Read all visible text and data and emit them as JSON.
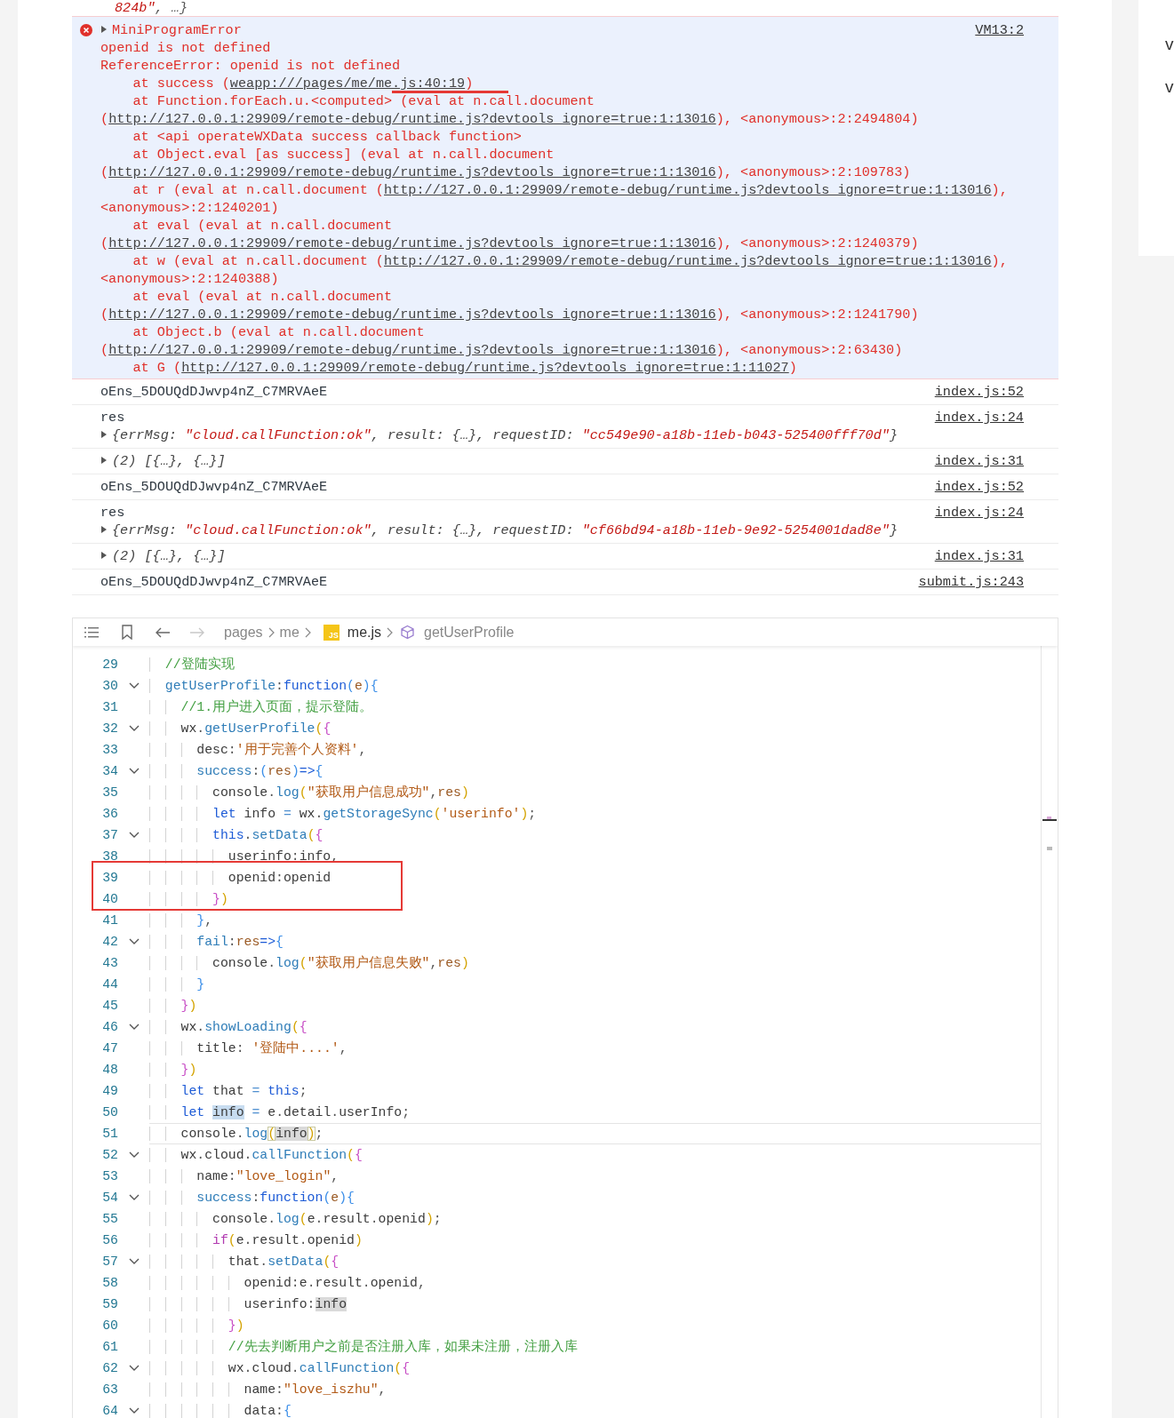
{
  "console": {
    "rows": [
      {
        "kind": "continuation",
        "parts": [
          {
            "kind": "string",
            "text": "824b\""
          },
          {
            "kind": "plain",
            "text": ", …}"
          }
        ]
      },
      {
        "kind": "error",
        "title": "MiniProgramError",
        "expanded": false,
        "source": "VM13:2",
        "lines": [
          {
            "kind": "message",
            "text": "openid is not defined"
          },
          {
            "kind": "message",
            "text": "ReferenceError: openid is not defined"
          },
          {
            "kind": "frame",
            "text": "at success (",
            "link": "weapp:///pages/me/me.js:40:19",
            "after": ")"
          },
          {
            "kind": "frame",
            "text": "at Function.forEach.u.<computed> (eval at n.call.document (",
            "link": "http://127.0.0.1:29909/remote-debug/runtime.js?devtools_ignore=true:1:13016",
            "after": "), <anonymous>:2:2494804)"
          },
          {
            "kind": "frame",
            "text": "at <api operateWXData success callback function>"
          },
          {
            "kind": "frame",
            "text": "at Object.eval [as success] (eval at n.call.document (",
            "link": "http://127.0.0.1:29909/remote-debug/runtime.js?devtools_ignore=true:1:13016",
            "after": "), <anonymous>:2:109783)"
          },
          {
            "kind": "frame",
            "text": "at r (eval at n.call.document (",
            "link": "http://127.0.0.1:29909/remote-debug/runtime.js?devtools_ignore=true:1:13016",
            "after": "), <anonymous>:2:1240201)"
          },
          {
            "kind": "frame",
            "text": "at eval (eval at n.call.document (",
            "link": "http://127.0.0.1:29909/remote-debug/runtime.js?devtools_ignore=true:1:13016",
            "after": "), <anonymous>:2:1240379)"
          },
          {
            "kind": "frame",
            "text": "at w (eval at n.call.document (",
            "link": "http://127.0.0.1:29909/remote-debug/runtime.js?devtools_ignore=true:1:13016",
            "after": "), <anonymous>:2:1240388)"
          },
          {
            "kind": "frame",
            "text": "at eval (eval at n.call.document (",
            "link": "http://127.0.0.1:29909/remote-debug/runtime.js?devtools_ignore=true:1:13016",
            "after": "), <anonymous>:2:1241790)"
          },
          {
            "kind": "frame",
            "text": "at Object.b (eval at n.call.document (",
            "link": "http://127.0.0.1:29909/remote-debug/runtime.js?devtools_ignore=true:1:13016",
            "after": "), <anonymous>:2:63430)"
          },
          {
            "kind": "frame",
            "text": "at G (",
            "link": "http://127.0.0.1:29909/remote-debug/runtime.js?devtools_ignore=true:1:11027",
            "after": ")"
          }
        ]
      },
      {
        "kind": "log",
        "text": "oEns_5DOUQdDJwvp4nZ_C7MRVAeE",
        "source": "index.js:52"
      },
      {
        "kind": "log",
        "text": "res",
        "source": "index.js:24",
        "object": {
          "expanded": false,
          "parts": [
            {
              "kind": "plain",
              "text": "{errMsg: "
            },
            {
              "kind": "string",
              "text": "\"cloud.callFunction:ok\""
            },
            {
              "kind": "plain",
              "text": ", result: {…}, requestID: "
            },
            {
              "kind": "string",
              "text": "\"cc549e90-a18b-11eb-b043-525400fff70d\""
            },
            {
              "kind": "plain",
              "text": "}"
            }
          ]
        }
      },
      {
        "kind": "object",
        "source": "index.js:31",
        "object": {
          "expanded": false,
          "parts": [
            {
              "kind": "plain",
              "text": "(2) [{…}, {…}]"
            }
          ]
        }
      },
      {
        "kind": "log",
        "text": "oEns_5DOUQdDJwvp4nZ_C7MRVAeE",
        "source": "index.js:52"
      },
      {
        "kind": "log",
        "text": "res",
        "source": "index.js:24",
        "object": {
          "expanded": false,
          "parts": [
            {
              "kind": "plain",
              "text": "{errMsg: "
            },
            {
              "kind": "string",
              "text": "\"cloud.callFunction:ok\""
            },
            {
              "kind": "plain",
              "text": ", result: {…}, requestID: "
            },
            {
              "kind": "string",
              "text": "\"cf66bd94-a18b-11eb-9e92-5254001dad8e\""
            },
            {
              "kind": "plain",
              "text": "}"
            }
          ]
        }
      },
      {
        "kind": "object",
        "source": "index.js:31",
        "object": {
          "expanded": false,
          "parts": [
            {
              "kind": "plain",
              "text": "(2) [{…}, {…}]"
            }
          ]
        }
      },
      {
        "kind": "log",
        "text": "oEns_5DOUQdDJwvp4nZ_C7MRVAeE",
        "source": "submit.js:243"
      }
    ]
  },
  "editor": {
    "back_disabled": false,
    "forward_disabled": true,
    "breadcrumb": [
      {
        "kind": "folder",
        "text": "pages"
      },
      {
        "kind": "folder",
        "text": "me"
      },
      {
        "kind": "file",
        "text": "me.js",
        "badge": "JS"
      },
      {
        "kind": "symbol",
        "text": "getUserProfile"
      }
    ],
    "lines": [
      {
        "number": "29",
        "fold": false,
        "current": false,
        "tokens": [
          {
            "kind": "comment",
            "text": "  //登陆实现"
          }
        ]
      },
      {
        "number": "30",
        "fold": true,
        "current": false,
        "tokens": [
          {
            "kind": "method",
            "text": "  getUserProfile"
          },
          {
            "kind": "punct",
            "text": ":"
          },
          {
            "kind": "keyword",
            "text": "function"
          },
          {
            "kind": "blue",
            "text": "("
          },
          {
            "kind": "param",
            "text": "e"
          },
          {
            "kind": "blue",
            "text": "){"
          }
        ]
      },
      {
        "number": "31",
        "fold": false,
        "current": false,
        "tokens": [
          {
            "kind": "comment",
            "text": "    //1.用户进入页面，提示登陆。"
          }
        ]
      },
      {
        "number": "32",
        "fold": true,
        "current": false,
        "tokens": [
          {
            "kind": "plain",
            "text": "    wx"
          },
          {
            "kind": "punct",
            "text": "."
          },
          {
            "kind": "method",
            "text": "getUserProfile"
          },
          {
            "kind": "gold",
            "text": "("
          },
          {
            "kind": "orchid",
            "text": "{"
          }
        ]
      },
      {
        "number": "33",
        "fold": false,
        "current": false,
        "tokens": [
          {
            "kind": "plain",
            "text": "      desc"
          },
          {
            "kind": "punct",
            "text": ":"
          },
          {
            "kind": "string",
            "text": "'用于完善个人资料'"
          },
          {
            "kind": "punct",
            "text": ","
          }
        ]
      },
      {
        "number": "34",
        "fold": true,
        "current": false,
        "tokens": [
          {
            "kind": "method",
            "text": "      success"
          },
          {
            "kind": "punct",
            "text": ":"
          },
          {
            "kind": "blue",
            "text": "("
          },
          {
            "kind": "param",
            "text": "res"
          },
          {
            "kind": "blue",
            "text": ")"
          },
          {
            "kind": "keyword",
            "text": "=>"
          },
          {
            "kind": "blue",
            "text": "{"
          }
        ]
      },
      {
        "number": "35",
        "fold": false,
        "current": false,
        "tokens": [
          {
            "kind": "plain",
            "text": "        console"
          },
          {
            "kind": "punct",
            "text": "."
          },
          {
            "kind": "method",
            "text": "log"
          },
          {
            "kind": "gold",
            "text": "("
          },
          {
            "kind": "string",
            "text": "\"获取用户信息成功\""
          },
          {
            "kind": "punct",
            "text": ","
          },
          {
            "kind": "param",
            "text": "res"
          },
          {
            "kind": "gold",
            "text": ")"
          }
        ]
      },
      {
        "number": "36",
        "fold": false,
        "current": false,
        "tokens": [
          {
            "kind": "keyword",
            "text": "        let"
          },
          {
            "kind": "plain",
            "text": " info "
          },
          {
            "kind": "op",
            "text": "="
          },
          {
            "kind": "plain",
            "text": " wx"
          },
          {
            "kind": "punct",
            "text": "."
          },
          {
            "kind": "method",
            "text": "getStorageSync"
          },
          {
            "kind": "gold",
            "text": "("
          },
          {
            "kind": "string",
            "text": "'userinfo'"
          },
          {
            "kind": "gold",
            "text": ")"
          },
          {
            "kind": "punct",
            "text": ";"
          }
        ]
      },
      {
        "number": "37",
        "fold": true,
        "current": false,
        "tokens": [
          {
            "kind": "keyword",
            "text": "        this"
          },
          {
            "kind": "punct",
            "text": "."
          },
          {
            "kind": "method",
            "text": "setData"
          },
          {
            "kind": "gold",
            "text": "("
          },
          {
            "kind": "orchid",
            "text": "{"
          }
        ]
      },
      {
        "number": "38",
        "fold": false,
        "current": false,
        "tokens": [
          {
            "kind": "plain",
            "text": "          userinfo"
          },
          {
            "kind": "punct",
            "text": ":"
          },
          {
            "kind": "plain",
            "text": "info"
          },
          {
            "kind": "punct",
            "text": ","
          }
        ]
      },
      {
        "number": "39",
        "fold": false,
        "current": false,
        "tokens": [
          {
            "kind": "plain",
            "text": "          openid"
          },
          {
            "kind": "punct",
            "text": ":"
          },
          {
            "kind": "plain",
            "text": "openid"
          }
        ]
      },
      {
        "number": "40",
        "fold": false,
        "current": false,
        "tokens": [
          {
            "kind": "orchid",
            "text": "        }"
          },
          {
            "kind": "gold",
            "text": ")"
          }
        ]
      },
      {
        "number": "41",
        "fold": false,
        "current": false,
        "tokens": [
          {
            "kind": "blue",
            "text": "      }"
          },
          {
            "kind": "punct",
            "text": ","
          }
        ]
      },
      {
        "number": "42",
        "fold": true,
        "current": false,
        "tokens": [
          {
            "kind": "method",
            "text": "      fail"
          },
          {
            "kind": "punct",
            "text": ":"
          },
          {
            "kind": "param",
            "text": "res"
          },
          {
            "kind": "keyword",
            "text": "=>"
          },
          {
            "kind": "blue",
            "text": "{"
          }
        ]
      },
      {
        "number": "43",
        "fold": false,
        "current": false,
        "tokens": [
          {
            "kind": "plain",
            "text": "        console"
          },
          {
            "kind": "punct",
            "text": "."
          },
          {
            "kind": "method",
            "text": "log"
          },
          {
            "kind": "gold",
            "text": "("
          },
          {
            "kind": "string",
            "text": "\"获取用户信息失败\""
          },
          {
            "kind": "punct",
            "text": ","
          },
          {
            "kind": "param",
            "text": "res"
          },
          {
            "kind": "gold",
            "text": ")"
          }
        ]
      },
      {
        "number": "44",
        "fold": false,
        "current": false,
        "tokens": [
          {
            "kind": "blue",
            "text": "      }"
          }
        ]
      },
      {
        "number": "45",
        "fold": false,
        "current": false,
        "tokens": [
          {
            "kind": "orchid",
            "text": "    }"
          },
          {
            "kind": "gold",
            "text": ")"
          }
        ]
      },
      {
        "number": "46",
        "fold": true,
        "current": false,
        "tokens": [
          {
            "kind": "plain",
            "text": "    wx"
          },
          {
            "kind": "punct",
            "text": "."
          },
          {
            "kind": "method",
            "text": "showLoading"
          },
          {
            "kind": "gold",
            "text": "("
          },
          {
            "kind": "orchid",
            "text": "{"
          }
        ]
      },
      {
        "number": "47",
        "fold": false,
        "current": false,
        "tokens": [
          {
            "kind": "plain",
            "text": "      title"
          },
          {
            "kind": "punct",
            "text": ": "
          },
          {
            "kind": "string",
            "text": "'登陆中....'"
          },
          {
            "kind": "punct",
            "text": ","
          }
        ]
      },
      {
        "number": "48",
        "fold": false,
        "current": false,
        "tokens": [
          {
            "kind": "orchid",
            "text": "    }"
          },
          {
            "kind": "gold",
            "text": ")"
          }
        ]
      },
      {
        "number": "49",
        "fold": false,
        "current": false,
        "tokens": [
          {
            "kind": "keyword",
            "text": "    let"
          },
          {
            "kind": "plain",
            "text": " that "
          },
          {
            "kind": "op",
            "text": "="
          },
          {
            "kind": "keyword",
            "text": " this"
          },
          {
            "kind": "punct",
            "text": ";"
          }
        ]
      },
      {
        "number": "50",
        "fold": false,
        "current": false,
        "tokens": [
          {
            "kind": "keyword",
            "text": "    let "
          },
          {
            "kind": "plain",
            "text": "info",
            "selected": true
          },
          {
            "kind": "op",
            "text": " = "
          },
          {
            "kind": "plain",
            "text": "e"
          },
          {
            "kind": "punct",
            "text": "."
          },
          {
            "kind": "plain",
            "text": "detail"
          },
          {
            "kind": "punct",
            "text": "."
          },
          {
            "kind": "plain",
            "text": "userInfo"
          },
          {
            "kind": "punct",
            "text": ";"
          }
        ]
      },
      {
        "number": "51",
        "fold": false,
        "current": true,
        "tokens": [
          {
            "kind": "plain",
            "text": "    console"
          },
          {
            "kind": "punct",
            "text": "."
          },
          {
            "kind": "method",
            "text": "log"
          },
          {
            "kind": "gold",
            "text": "(",
            "bracket_match": true
          },
          {
            "kind": "plain",
            "text": "info",
            "word_match": true
          },
          {
            "kind": "gold",
            "text": ")",
            "bracket_match": true
          },
          {
            "kind": "punct",
            "text": ";"
          }
        ]
      },
      {
        "number": "52",
        "fold": true,
        "current": false,
        "tokens": [
          {
            "kind": "plain",
            "text": "    wx"
          },
          {
            "kind": "punct",
            "text": "."
          },
          {
            "kind": "plain",
            "text": "cloud"
          },
          {
            "kind": "punct",
            "text": "."
          },
          {
            "kind": "method",
            "text": "callFunction"
          },
          {
            "kind": "gold",
            "text": "("
          },
          {
            "kind": "orchid",
            "text": "{"
          }
        ]
      },
      {
        "number": "53",
        "fold": false,
        "current": false,
        "tokens": [
          {
            "kind": "plain",
            "text": "      name"
          },
          {
            "kind": "punct",
            "text": ":"
          },
          {
            "kind": "string",
            "text": "\"love_login\""
          },
          {
            "kind": "punct",
            "text": ","
          }
        ]
      },
      {
        "number": "54",
        "fold": true,
        "current": false,
        "tokens": [
          {
            "kind": "method",
            "text": "      success"
          },
          {
            "kind": "punct",
            "text": ":"
          },
          {
            "kind": "keyword",
            "text": "function"
          },
          {
            "kind": "blue",
            "text": "("
          },
          {
            "kind": "param",
            "text": "e"
          },
          {
            "kind": "blue",
            "text": "){"
          }
        ]
      },
      {
        "number": "55",
        "fold": false,
        "current": false,
        "tokens": [
          {
            "kind": "plain",
            "text": "        console"
          },
          {
            "kind": "punct",
            "text": "."
          },
          {
            "kind": "method",
            "text": "log"
          },
          {
            "kind": "gold",
            "text": "("
          },
          {
            "kind": "plain",
            "text": "e"
          },
          {
            "kind": "punct",
            "text": "."
          },
          {
            "kind": "plain",
            "text": "result"
          },
          {
            "kind": "punct",
            "text": "."
          },
          {
            "kind": "plain",
            "text": "openid"
          },
          {
            "kind": "gold",
            "text": ")"
          },
          {
            "kind": "punct",
            "text": ";"
          }
        ]
      },
      {
        "number": "56",
        "fold": false,
        "current": false,
        "tokens": [
          {
            "kind": "control",
            "text": "        if"
          },
          {
            "kind": "gold",
            "text": "("
          },
          {
            "kind": "plain",
            "text": "e"
          },
          {
            "kind": "punct",
            "text": "."
          },
          {
            "kind": "plain",
            "text": "result"
          },
          {
            "kind": "punct",
            "text": "."
          },
          {
            "kind": "plain",
            "text": "openid"
          },
          {
            "kind": "gold",
            "text": ")"
          }
        ]
      },
      {
        "number": "57",
        "fold": true,
        "current": false,
        "tokens": [
          {
            "kind": "plain",
            "text": "          that"
          },
          {
            "kind": "punct",
            "text": "."
          },
          {
            "kind": "method",
            "text": "setData"
          },
          {
            "kind": "gold",
            "text": "("
          },
          {
            "kind": "orchid",
            "text": "{"
          }
        ]
      },
      {
        "number": "58",
        "fold": false,
        "current": false,
        "tokens": [
          {
            "kind": "plain",
            "text": "            openid"
          },
          {
            "kind": "punct",
            "text": ":"
          },
          {
            "kind": "plain",
            "text": "e"
          },
          {
            "kind": "punct",
            "text": "."
          },
          {
            "kind": "plain",
            "text": "result"
          },
          {
            "kind": "punct",
            "text": "."
          },
          {
            "kind": "plain",
            "text": "openid"
          },
          {
            "kind": "punct",
            "text": ","
          }
        ]
      },
      {
        "number": "59",
        "fold": false,
        "current": false,
        "tokens": [
          {
            "kind": "plain",
            "text": "            userinfo"
          },
          {
            "kind": "punct",
            "text": ":"
          },
          {
            "kind": "plain",
            "text": "info",
            "word_match": true
          }
        ]
      },
      {
        "number": "60",
        "fold": false,
        "current": false,
        "tokens": [
          {
            "kind": "orchid",
            "text": "          }"
          },
          {
            "kind": "gold",
            "text": ")"
          }
        ]
      },
      {
        "number": "61",
        "fold": false,
        "current": false,
        "tokens": [
          {
            "kind": "comment",
            "text": "          //先去判断用户之前是否注册入库，如果未注册，注册入库"
          }
        ]
      },
      {
        "number": "62",
        "fold": true,
        "current": false,
        "tokens": [
          {
            "kind": "plain",
            "text": "          wx"
          },
          {
            "kind": "punct",
            "text": "."
          },
          {
            "kind": "plain",
            "text": "cloud"
          },
          {
            "kind": "punct",
            "text": "."
          },
          {
            "kind": "method",
            "text": "callFunction"
          },
          {
            "kind": "gold",
            "text": "("
          },
          {
            "kind": "orchid",
            "text": "{"
          }
        ]
      },
      {
        "number": "63",
        "fold": false,
        "current": false,
        "tokens": [
          {
            "kind": "plain",
            "text": "            name"
          },
          {
            "kind": "punct",
            "text": ":"
          },
          {
            "kind": "string",
            "text": "\"love_iszhu\""
          },
          {
            "kind": "punct",
            "text": ","
          }
        ]
      },
      {
        "number": "64",
        "fold": true,
        "current": false,
        "tokens": [
          {
            "kind": "plain",
            "text": "            data"
          },
          {
            "kind": "punct",
            "text": ":"
          },
          {
            "kind": "blue",
            "text": "{"
          }
        ]
      }
    ]
  },
  "annotations": {
    "underline": true,
    "box": true
  },
  "side_card": {
    "items": [
      "v",
      "v"
    ]
  }
}
